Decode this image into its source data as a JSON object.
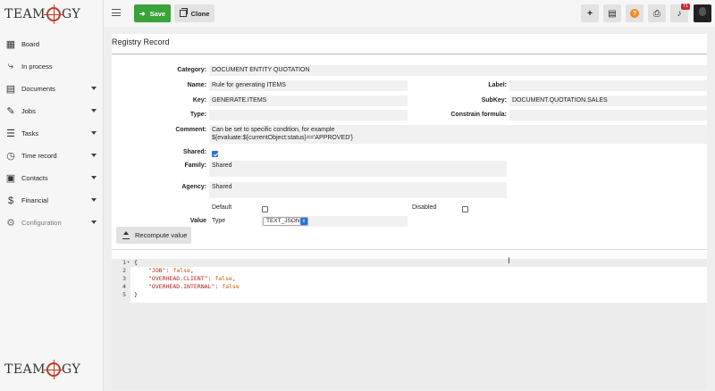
{
  "app": {
    "logo_text_left": "TEAM",
    "logo_text_right": "GY"
  },
  "sidebar": {
    "items": [
      {
        "label": "Board",
        "icon": "grid-icon"
      },
      {
        "label": "In process",
        "icon": "flow-icon"
      },
      {
        "label": "Documents",
        "icon": "document-icon"
      },
      {
        "label": "Jobs",
        "icon": "wrench-icon"
      },
      {
        "label": "Tasks",
        "icon": "list-icon"
      },
      {
        "label": "Time record",
        "icon": "clock-icon"
      },
      {
        "label": "Contacts",
        "icon": "contacts-icon"
      },
      {
        "label": "Financial",
        "icon": "dollar-icon"
      },
      {
        "label": "Configuration",
        "icon": "gear-icon"
      }
    ]
  },
  "toolbar": {
    "save_label": "Save",
    "clone_label": "Clone",
    "notification_count": "71"
  },
  "record": {
    "page_title": "Registry Record",
    "category_label": "Category:",
    "category_value": "DOCUMENT ENTITY QUOTATION",
    "name_label": "Name:",
    "name_value": "Rule for generating ITEMS",
    "label_label": "Label:",
    "label_value": "",
    "key_label": "Key:",
    "key_value": "GENERATE.ITEMS",
    "subkey_label": "SubKey:",
    "subkey_value": "DOCUMENT.QUOTATION.SALES",
    "type_label": "Type:",
    "type_value": "",
    "constrain_label": "Constrain formula:",
    "constrain_value": "",
    "comment_label": "Comment:",
    "comment_line1": "Can be set to specific condition, for example",
    "comment_line2": "${evaluate:${currentObject:status}=='APPROVED'}",
    "shared_label": "Shared:",
    "shared_checked": true,
    "family_label": "Family:",
    "family_value": "Shared",
    "agency_label": "Agency:",
    "agency_value": "Shared",
    "default_label": "Default",
    "disabled_label": "Disabled",
    "value_label": "Value",
    "type_sub_label": "Type",
    "type_select_value": "TEXT_JSON",
    "recompute_label": "Recompute value"
  },
  "editor": {
    "lines": [
      {
        "n": "1",
        "fold": "▾",
        "text": "{"
      },
      {
        "n": "2",
        "key": "\"JOB\"",
        "sep": ": ",
        "val": "false",
        "end": ","
      },
      {
        "n": "3",
        "key": "\"OVERHEAD.CLIENT\"",
        "sep": ": ",
        "val": "false",
        "end": ","
      },
      {
        "n": "4",
        "key": "\"OVERHEAD.INTERNAL\"",
        "sep": ": ",
        "val": "false",
        "end": ""
      },
      {
        "n": "5",
        "text": "}"
      }
    ]
  }
}
